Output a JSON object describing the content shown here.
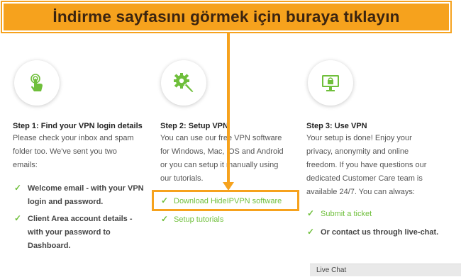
{
  "banner": {
    "text": "İndirme sayfasını görmek için buraya tıklayın"
  },
  "colors": {
    "accent_orange": "#f6a21d",
    "green": "#6fbf3b"
  },
  "steps": [
    {
      "icon": "tap-finger-icon",
      "title": "Step 1: Find your VPN login details",
      "lines": [
        "Please check your inbox and spam",
        "folder too. We've sent you two",
        "emails:"
      ],
      "items": [
        {
          "lines": [
            "Welcome email - with your VPN",
            "login and password."
          ]
        },
        {
          "lines": [
            "Client Area account details -",
            "with your password to",
            "Dashboard."
          ]
        }
      ]
    },
    {
      "icon": "gear-wrench-icon",
      "title": "Step 2: Setup VPN",
      "lines": [
        "You can use our free VPN software",
        "for Windows, Mac, iOS and Android",
        "or you can setup it manually using",
        "our tutorials."
      ],
      "items": [
        {
          "lines": [
            "Download HideIPVPN software"
          ]
        },
        {
          "lines": [
            "Setup tutorials"
          ]
        }
      ]
    },
    {
      "icon": "monitor-lock-icon",
      "title": "Step 3: Use VPN",
      "lines": [
        "Your setup is done! Enjoy your",
        "privacy, anonymity and online",
        "freedom. If you have questions our",
        "dedicated Customer Care team is",
        "available 24/7. You can always:"
      ],
      "items": [
        {
          "lines": [
            "Submit a ticket"
          ]
        },
        {
          "lines": [
            "Or contact us through live-chat."
          ]
        }
      ]
    }
  ],
  "check_glyph": "✓",
  "live_chat": {
    "label": "Live Chat"
  }
}
